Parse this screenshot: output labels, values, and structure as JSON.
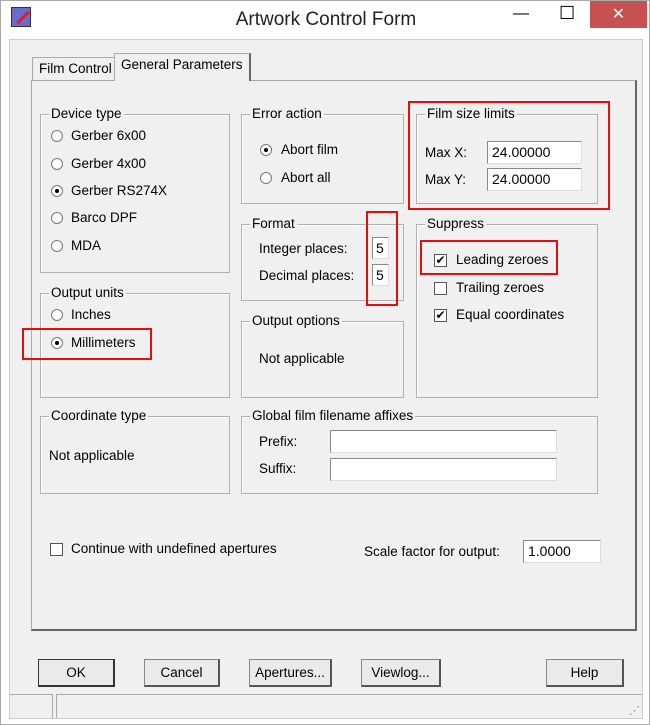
{
  "window": {
    "title": "Artwork Control Form",
    "minimize": "—",
    "maximize": "☐",
    "close": "✕"
  },
  "tabs": [
    {
      "label": "Film Control",
      "active": false
    },
    {
      "label": "General Parameters",
      "active": true
    }
  ],
  "device_type": {
    "label": "Device type",
    "options": [
      "Gerber 6x00",
      "Gerber 4x00",
      "Gerber RS274X",
      "Barco DPF",
      "MDA"
    ],
    "selected": "Gerber RS274X"
  },
  "output_units": {
    "label": "Output units",
    "options": [
      "Inches",
      "Millimeters"
    ],
    "selected": "Millimeters"
  },
  "coordinate_type": {
    "label": "Coordinate type",
    "value": "Not applicable"
  },
  "error_action": {
    "label": "Error action",
    "options": [
      "Abort film",
      "Abort all"
    ],
    "selected": "Abort film"
  },
  "format": {
    "label": "Format",
    "integer_label": "Integer places:",
    "integer_value": "5",
    "decimal_label": "Decimal places:",
    "decimal_value": "5"
  },
  "output_options": {
    "label": "Output options",
    "value": "Not applicable"
  },
  "film_size": {
    "label": "Film size limits",
    "max_x_label": "Max X:",
    "max_x": "24.00000",
    "max_y_label": "Max Y:",
    "max_y": "24.00000"
  },
  "suppress": {
    "label": "Suppress",
    "items": [
      {
        "label": "Leading zeroes",
        "checked": true
      },
      {
        "label": "Trailing zeroes",
        "checked": false
      },
      {
        "label": "Equal coordinates",
        "checked": true
      }
    ]
  },
  "affixes": {
    "label": "Global film filename affixes",
    "prefix_label": "Prefix:",
    "prefix": "",
    "suffix_label": "Suffix:",
    "suffix": ""
  },
  "continue": {
    "label": "Continue with undefined apertures",
    "checked": false
  },
  "scale": {
    "label": "Scale factor for output:",
    "value": "1.0000"
  },
  "buttons": {
    "ok": "OK",
    "cancel": "Cancel",
    "apertures": "Apertures...",
    "viewlog": "Viewlog...",
    "help": "Help"
  },
  "highlight_color": "#e01010"
}
